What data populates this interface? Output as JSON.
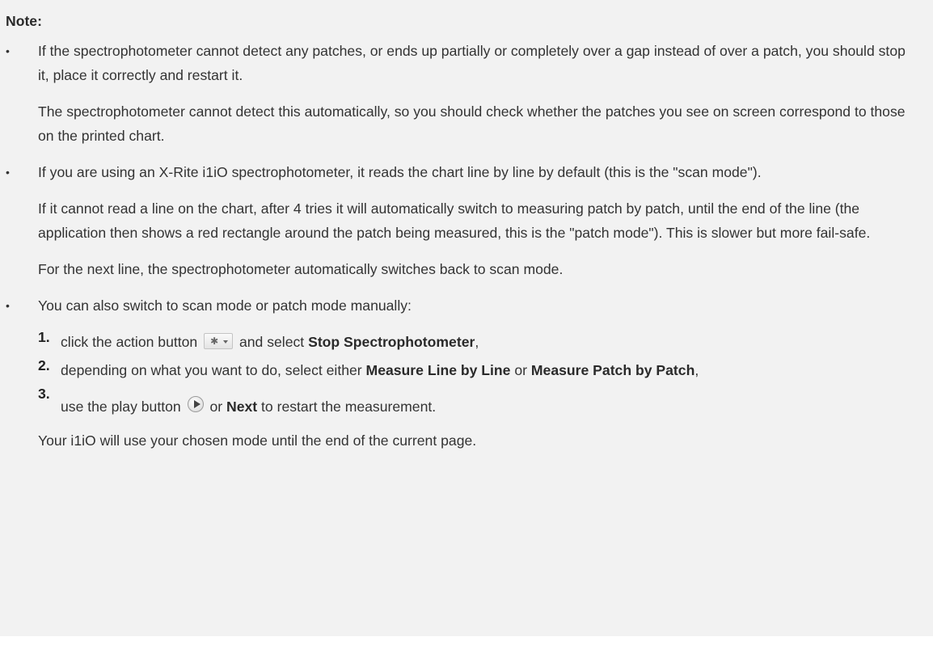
{
  "note": {
    "title": "Note:",
    "items": [
      {
        "p1": "If the spectrophotometer cannot detect any patches, or ends up partially or completely over a gap instead of over a patch, you should stop it, place it correctly and restart it.",
        "p2": "The spectrophotometer cannot detect this automatically, so you should check whether the patches you see on screen correspond to those on the printed chart."
      },
      {
        "p1": "If you are using an X-Rite i1iO spectrophotometer, it reads the chart line by line by default (this is the \"scan mode\").",
        "p2": "If it cannot read a line on the chart, after 4 tries it will automatically switch to measuring patch by patch, until the end of the line (the application then shows a red rectangle around the patch being measured, this is the \"patch mode\"). This is slower but more fail-safe.",
        "p3": "For the next line, the spectrophotometer automatically switches back to scan mode."
      },
      {
        "p1": "You can also switch to scan mode or patch mode manually:",
        "steps": [
          {
            "num": "1.",
            "pre": "click the action button",
            "mid": "and select",
            "bold": "Stop Spectrophotometer",
            "post": ","
          },
          {
            "num": "2.",
            "pre": "depending on what you want to do, select either",
            "bold1": "Measure Line by Line",
            "mid": "or",
            "bold2": "Measure Patch by Patch",
            "post": ","
          },
          {
            "num": "3.",
            "pre": "use the play button",
            "mid": "or",
            "bold": "Next",
            "post": "to restart the measurement."
          }
        ],
        "p2": "Your i1iO will use your chosen mode until the end of the current page."
      }
    ]
  },
  "icons": {
    "action_button": "gear-dropdown-icon",
    "play_button": "play-circle-icon"
  }
}
